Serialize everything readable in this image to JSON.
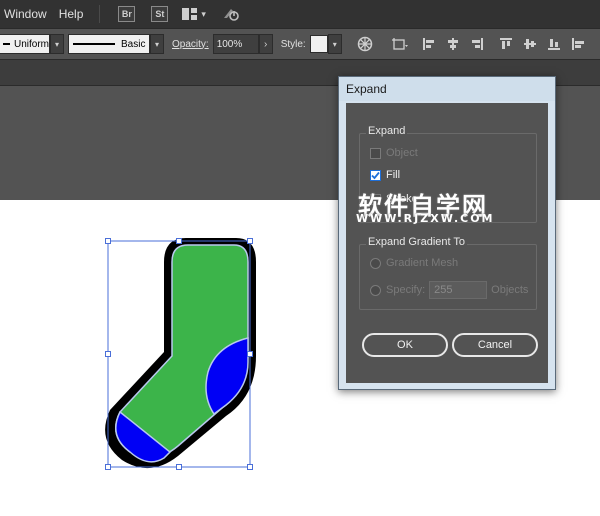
{
  "menubar": {
    "items": [
      "Window",
      "Help"
    ],
    "bridge_badge": "Br",
    "stock_badge": "St",
    "workspace_icon": "workspace-grid-icon",
    "sync_icon": "sync-icon"
  },
  "control_bar": {
    "stroke_profile": "Uniform",
    "brush": "Basic",
    "opacity_label": "Opacity:",
    "opacity_value": "100%",
    "style_label": "Style:",
    "icons": [
      "recolor-icon",
      "transform-icon",
      "align-left-icon",
      "align-hcenter-icon",
      "align-right-icon",
      "align-top-icon",
      "align-vcenter-icon",
      "align-bottom-icon",
      "distribute-icon"
    ]
  },
  "dialog": {
    "title": "Expand",
    "expand_group": {
      "title": "Expand",
      "object": {
        "label": "Object",
        "checked": false,
        "enabled": false
      },
      "fill": {
        "label": "Fill",
        "checked": true,
        "enabled": true
      },
      "stroke": {
        "label": "Stroke",
        "checked": false,
        "enabled": true
      }
    },
    "gradient_group": {
      "title": "Expand Gradient To",
      "gradient_mesh": {
        "label": "Gradient Mesh"
      },
      "specify": {
        "label": "Specify:",
        "value": "255",
        "unit": "Objects"
      }
    },
    "ok_label": "OK",
    "cancel_label": "Cancel"
  },
  "watermark": {
    "text": "软件自学网",
    "url": "WWW.RJZXW.COM"
  },
  "colors": {
    "sock_body": "#3cb44a",
    "sock_accent": "#0000f5",
    "outline": "#000000",
    "selection": "#4a6fd8"
  }
}
